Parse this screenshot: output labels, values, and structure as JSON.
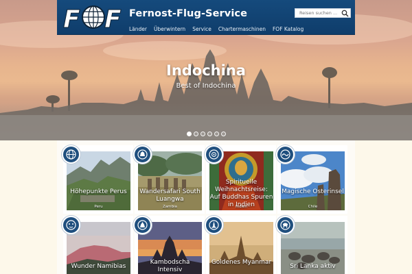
{
  "site": {
    "brand": "Fernost-Flug-Service",
    "logo_text": "FOF",
    "search_placeholder": "Reisen suchen ...",
    "nav": [
      "Länder",
      "Überwintern",
      "Service",
      "Chartermaschinen",
      "FOF Katalog"
    ]
  },
  "hero": {
    "title": "Indochina",
    "subtitle": "Best of Indochina",
    "slides": 6,
    "active_slide": 1
  },
  "cards": [
    {
      "title": "Höhepunkte Perus",
      "country": "Peru",
      "badge_icon": "globe-emblem-icon"
    },
    {
      "title": "Wandersafari South Luangwa",
      "country": "Zambia",
      "badge_icon": "animal-emblem-icon"
    },
    {
      "title": "Spirituelle Weihnachtsreise: Auf Buddhas Spuren in Indien",
      "country": "Indien",
      "badge_icon": "mandala-emblem-icon"
    },
    {
      "title": "Magische Osterinsel",
      "country": "Chile",
      "badge_icon": "wave-emblem-icon"
    },
    {
      "title": "Wunder Namibias",
      "country": "",
      "badge_icon": "leopard-emblem-icon"
    },
    {
      "title": "Kambodscha Intensiv",
      "country": "",
      "badge_icon": "temple-emblem-icon"
    },
    {
      "title": "Goldenes Myanmar",
      "country": "",
      "badge_icon": "pagoda-emblem-icon"
    },
    {
      "title": "Sri Lanka aktiv",
      "country": "",
      "badge_icon": "elephant-emblem-icon"
    }
  ],
  "colors": {
    "header": "#154a7c",
    "badge": "#1f4f7e",
    "page_bg": "#fdf8ea"
  }
}
